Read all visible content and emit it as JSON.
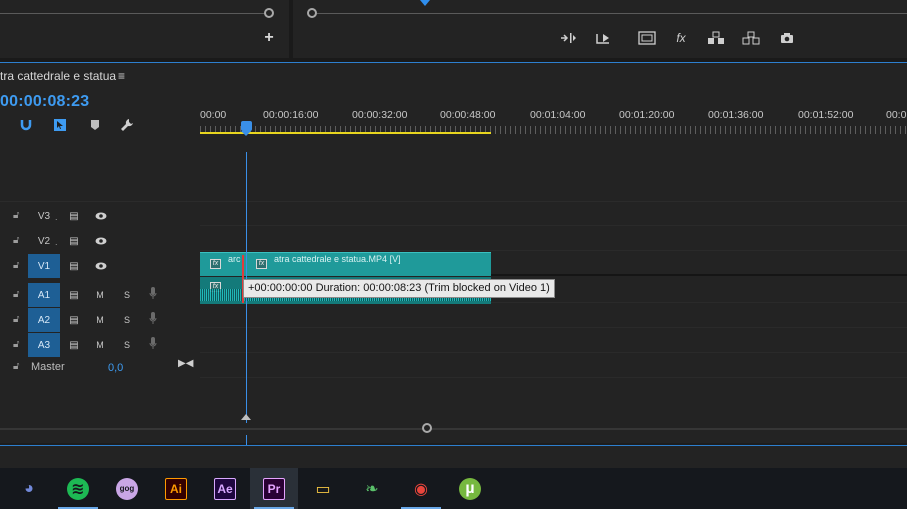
{
  "sequence": {
    "tab_title": "tra cattedrale e statua",
    "menu_icon": "hamburger-menu-icon",
    "timecode": "00:00:08:23"
  },
  "ruler": {
    "ticks": [
      "00:00",
      "00:00:16:00",
      "00:00:32:00",
      "00:00:48:00",
      "00:01:04:00",
      "00:01:20:00",
      "00:01:36:00",
      "00:01:52:00",
      "00:0"
    ]
  },
  "tracks": {
    "video": [
      {
        "name": "V3",
        "active": false
      },
      {
        "name": "V2",
        "active": false
      },
      {
        "name": "V1",
        "active": true
      }
    ],
    "audio": [
      {
        "name": "A1",
        "active": true,
        "m": "M",
        "s": "S"
      },
      {
        "name": "A2",
        "active": true,
        "m": "M",
        "s": "S"
      },
      {
        "name": "A3",
        "active": true,
        "m": "M",
        "s": "S"
      }
    ],
    "master_label": "Master",
    "master_value": "0,0"
  },
  "clips": {
    "video_label_1": "arc",
    "video_label_2": "atra cattedrale e statua.MP4 [V]",
    "fx": "fx"
  },
  "tooltip": "+00:00:00:00 Duration: 00:00:08:23 (Trim blocked on Video 1)",
  "taskbar": {
    "apps": [
      {
        "name": "Discord",
        "glyph": "◕",
        "color": "#7289da",
        "bg": "transparent",
        "active": false
      },
      {
        "name": "Spotify",
        "glyph": "≋",
        "color": "#15181d",
        "bg": "#1db954",
        "active": true
      },
      {
        "name": "GOG",
        "glyph": "gog",
        "color": "#15181d",
        "bg": "#c9a6e6",
        "active": false
      },
      {
        "name": "Illustrator",
        "glyph": "Ai",
        "color": "#ff9a00",
        "bg": "#330000",
        "active": false
      },
      {
        "name": "After Effects",
        "glyph": "Ae",
        "color": "#d8a8ff",
        "bg": "#1f0740",
        "active": false
      },
      {
        "name": "Premiere",
        "glyph": "Pr",
        "color": "#e5a3ff",
        "bg": "#2a0134",
        "active": true
      },
      {
        "name": "File Explorer",
        "glyph": "▭",
        "color": "#f4c542",
        "bg": "transparent",
        "active": false
      },
      {
        "name": "Evernote",
        "glyph": "❧",
        "color": "#5ac06a",
        "bg": "transparent",
        "active": false
      },
      {
        "name": "Chrome",
        "glyph": "◉",
        "color": "#e8453c",
        "bg": "transparent",
        "active": true
      },
      {
        "name": "uTorrent",
        "glyph": "µ",
        "color": "#ffffff",
        "bg": "#76b83f",
        "active": false
      }
    ]
  }
}
